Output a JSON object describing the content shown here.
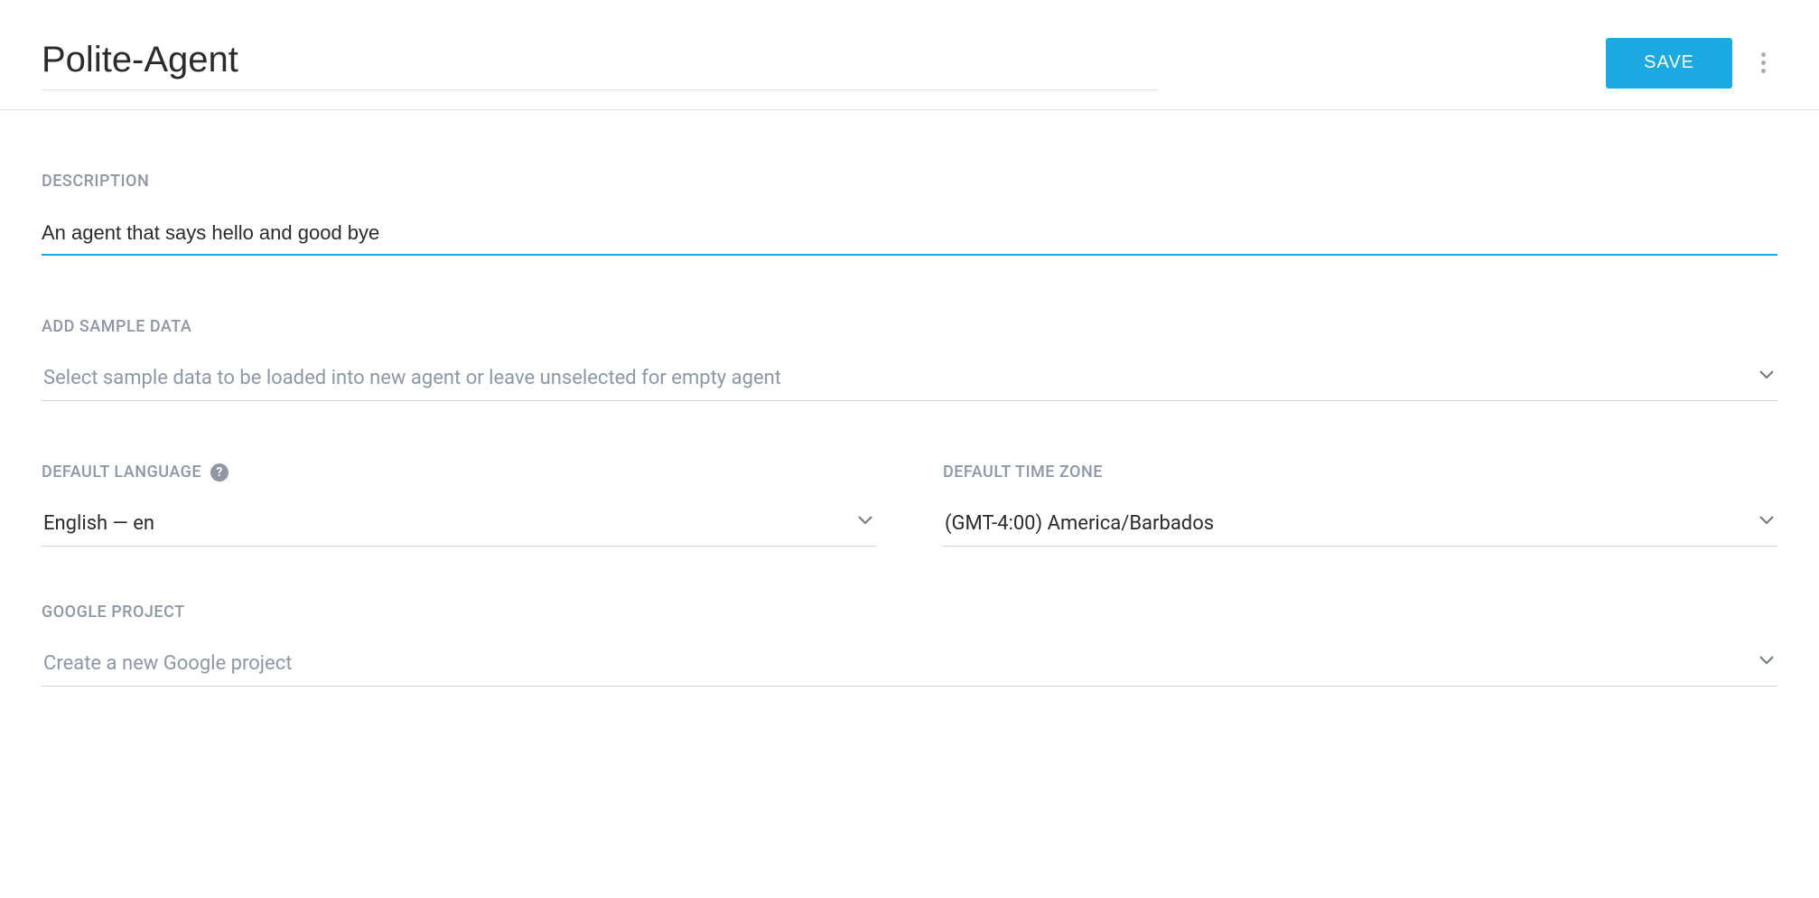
{
  "header": {
    "title": "Polite-Agent",
    "save_label": "SAVE"
  },
  "description": {
    "label": "DESCRIPTION",
    "value": "An agent that says hello and good bye"
  },
  "sample_data": {
    "label": "ADD SAMPLE DATA",
    "placeholder": "Select sample data to be loaded into new agent or leave unselected for empty agent"
  },
  "language": {
    "label": "DEFAULT LANGUAGE",
    "value": "English — en"
  },
  "timezone": {
    "label": "DEFAULT TIME ZONE",
    "value": "(GMT-4:00) America/Barbados"
  },
  "google_project": {
    "label": "GOOGLE PROJECT",
    "placeholder": "Create a new Google project"
  }
}
